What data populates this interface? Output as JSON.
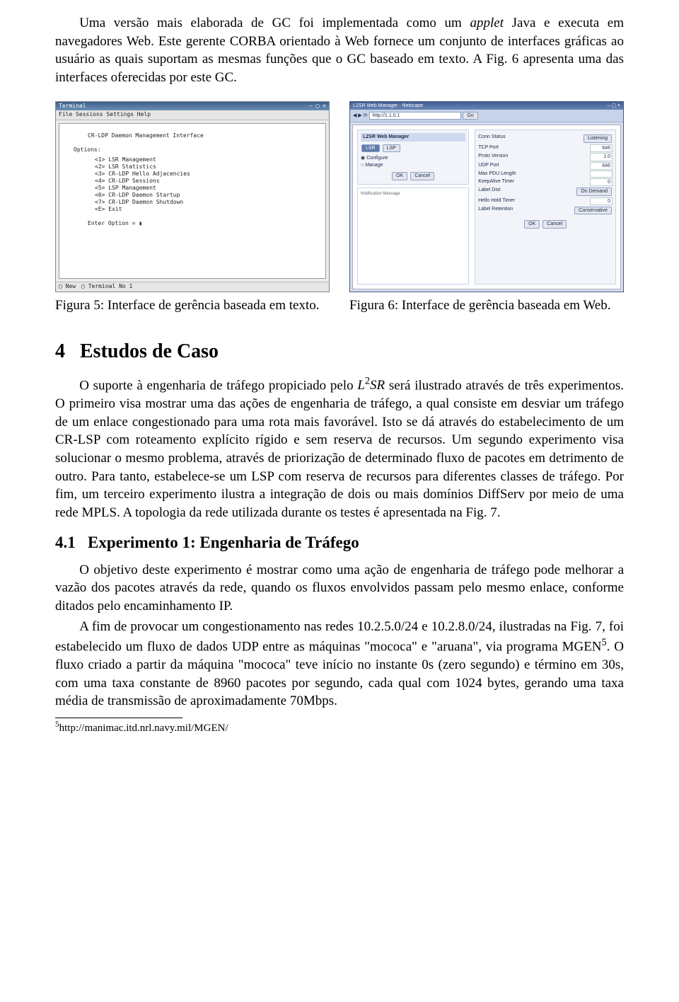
{
  "intro": {
    "p1a": "Uma versão mais elaborada de GC foi implementada como um ",
    "applet": "applet",
    "p1b": " Java e executa em navegadores Web. Este gerente CORBA orientado à Web fornece um conjunto de interfaces gráficas ao usuário as quais suportam as mesmas funções que o GC baseado em texto. A Fig. 6 apresenta uma das interfaces oferecidas por este GC."
  },
  "fig5": {
    "caption": "Figura 5: Interface de gerência baseada em texto.",
    "title": "Terminal",
    "menubar": "File  Sessions  Settings  Help",
    "header": "CR-LDP Daemon Management Interface",
    "options_label": "Options:",
    "opts": [
      "<1> LSR Management",
      "<2> LSR Statistics",
      "<3> CR-LDP Hello Adjacencies",
      "<4> CR-LDP Sessions",
      "<5> LSP Management",
      "<6> CR-LDP Daemon Startup",
      "<7> CR-LDP Daemon Shutdown",
      "<E> Exit"
    ],
    "prompt": "Enter Option = ",
    "status_new": "New",
    "status_tab": "Terminal No 1"
  },
  "fig6": {
    "caption": "Figura 6: Interface de gerência baseada em Web.",
    "title": "L2SR Web Manager - Netscape",
    "url": "http://1.1.0.1",
    "btn_go": "Go",
    "panel_title": "L2SR Web Manager",
    "tab1": "LSR",
    "tab2": "LSP",
    "radio_conf": "Configure",
    "radio_mng": "Manage",
    "btn_ok": "OK",
    "btn_cancel": "Cancel",
    "fields": {
      "conn_status": "Conn Status",
      "conn_status_val": "Listening",
      "proto_version": "Proto Version",
      "proto_version_val": "1.0",
      "tcp_port": "TCP Port",
      "tcp_port_val": "646",
      "udp_port": "UDP Port",
      "udp_port_val": "646",
      "max_pdu": "Max PDU Length",
      "max_pdu_val": "",
      "keepalive": "KeepAlive Timer",
      "keepalive_val": "0",
      "label_dist": "Label Dist",
      "label_dist_val": "On Demand",
      "hello_hold": "Hello Hold Timer",
      "hello_hold_val": "0",
      "label_ret": "Label Retention",
      "label_ret_val": "Conservative"
    },
    "notif": "Notification Message"
  },
  "section": {
    "num": "4",
    "title": "Estudos de Caso"
  },
  "p2a": "O suporte à engenharia de tráfego propiciado pelo ",
  "l2sr": "L²SR",
  "p2b": " será ilustrado através de três experimentos. O primeiro visa mostrar uma das ações de engenharia de tráfego, a qual consiste em desviar um tráfego de um enlace congestionado para uma rota mais favorável. Isto se dá através do estabelecimento de um CR-LSP com roteamento explícito rígido e sem reserva de recursos. Um segundo experimento visa solucionar o mesmo problema, através de priorização de determinado fluxo de pacotes em detrimento de outro. Para tanto, estabelece-se um LSP com reserva de recursos para diferentes classes de tráfego. Por fim, um terceiro experimento ilustra a integração de dois ou mais domínios DiffServ por meio de uma rede MPLS. A topologia da rede utilizada durante os testes é apresentada na Fig. 7.",
  "subsection": {
    "num": "4.1",
    "title": "Experimento 1: Engenharia de Tráfego"
  },
  "p3": "O objetivo deste experimento é mostrar como uma ação de engenharia de tráfego pode melhorar a vazão dos pacotes através da rede, quando os fluxos envolvidos passam pelo mesmo enlace, conforme ditados pelo encaminhamento IP.",
  "p4a": "A fim de provocar um congestionamento nas redes 10.2.5.0/24 e 10.2.8.0/24, ilustradas na Fig. 7, foi estabelecido um fluxo de dados UDP entre as máquinas \"mococa\" e \"aruana\", via programa MGEN",
  "fn_mark": "5",
  "p4b": ". O fluxo criado a partir da máquina \"mococa\" teve início no instante 0s (zero segundo) e término em 30s, com uma taxa constante de 8960 pacotes por segundo, cada qual com 1024 bytes, gerando uma taxa média de transmissão de aproximadamente 70Mbps.",
  "footnote": {
    "mark": "5",
    "text": "http://manimac.itd.nrl.navy.mil/MGEN/"
  }
}
